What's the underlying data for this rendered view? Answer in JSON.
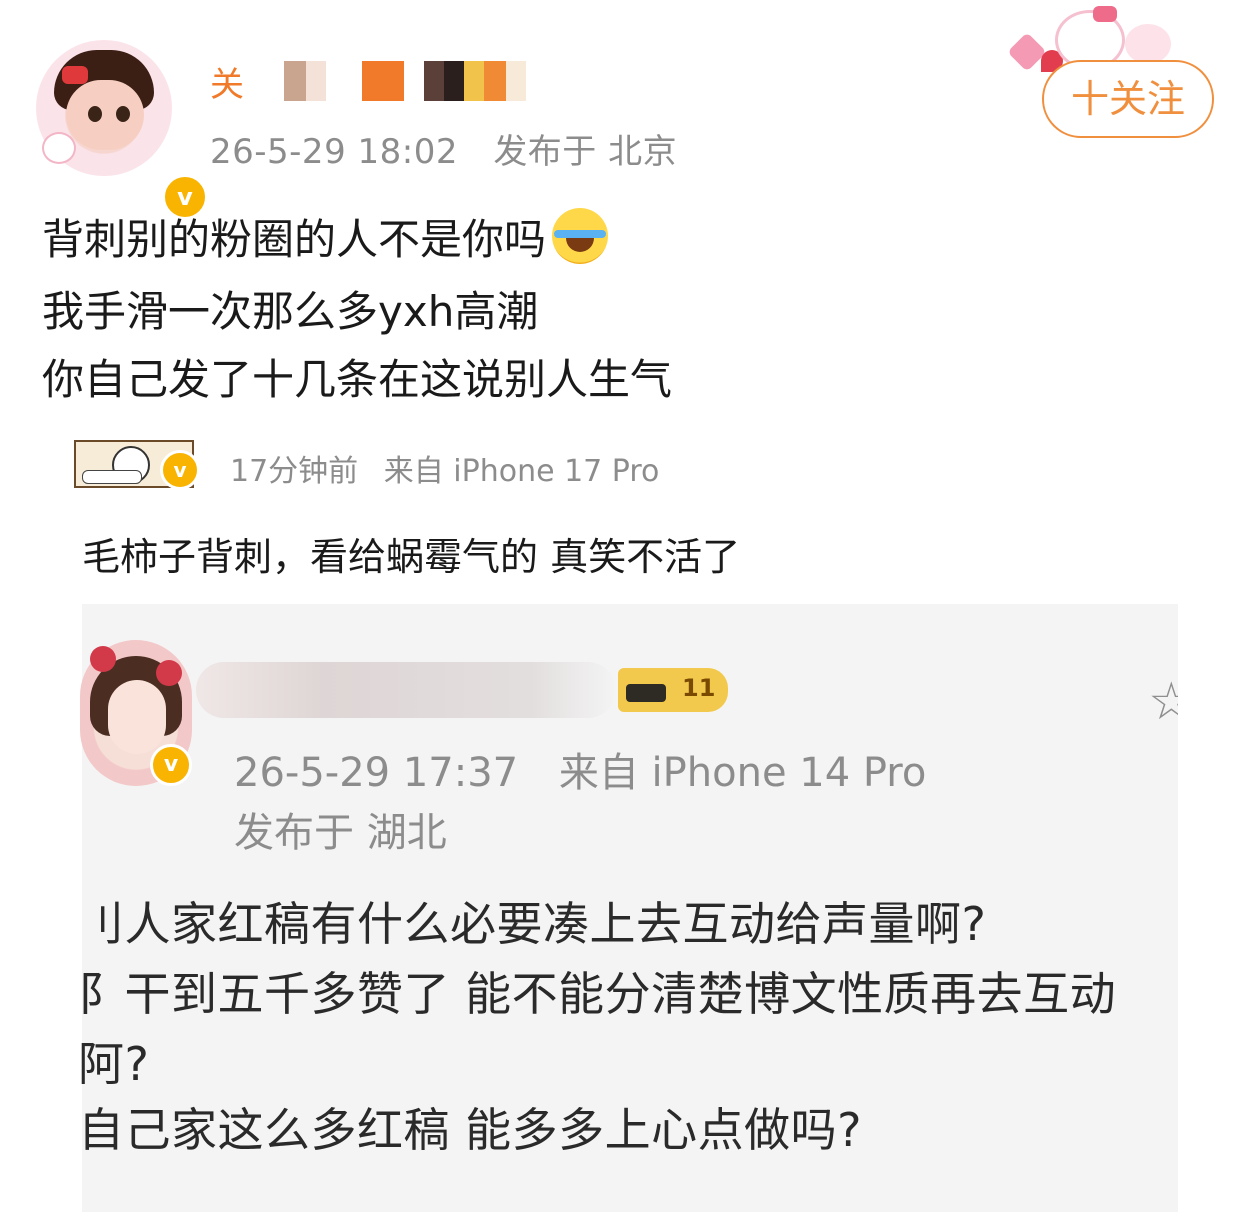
{
  "post": {
    "author_first_char": "关",
    "timestamp": "26-5-29 18:02",
    "location": "发布于 北京",
    "follow_label": "十关注",
    "body_lines": [
      "背刺别的粉圈的人不是你吗",
      "我手滑一次那么多yxh高潮",
      "你自己发了十几条在这说别人生气"
    ],
    "body_emoji": "laughing-with-tears"
  },
  "comment": {
    "time": "17分钟前",
    "source": "来自 iPhone 17 Pro",
    "text": "毛柿子背刺，看给蜗霉气的 真笑不活了"
  },
  "quoted": {
    "timestamp": "26-5-29 17:37",
    "source": "来自 iPhone 14 Pro",
    "location": "发布于 湖北",
    "level": "11",
    "lines": [
      "刂人家红稿有什么必要凑上去互动给声量啊?",
      "阝干到五千多赞了 能不能分清楚博文性质再去互动",
      "阿?",
      "自己家这么多红稿 能多多上心点做吗?"
    ]
  },
  "colors": {
    "accent": "#f08f3d",
    "meta_gray": "#8c8c8c",
    "verified_badge": "#f8b400"
  },
  "icons": [
    "verified-icon",
    "star-icon",
    "laughing-emoji-icon"
  ]
}
